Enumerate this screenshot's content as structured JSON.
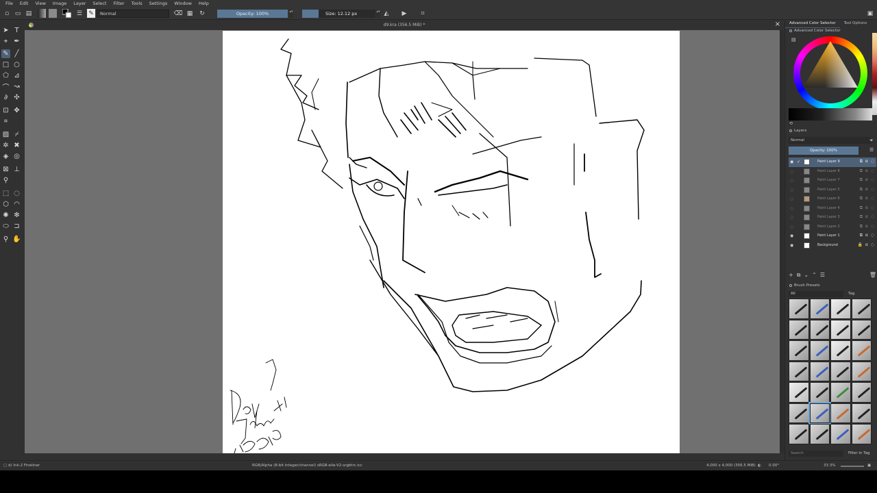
{
  "menu": [
    "File",
    "Edit",
    "View",
    "Image",
    "Layer",
    "Select",
    "Filter",
    "Tools",
    "Settings",
    "Window",
    "Help"
  ],
  "toolbar": {
    "blend_mode": "Normal",
    "opacity": "Opacity: 100%",
    "size": "Size: 12.12 px"
  },
  "document": {
    "title": "d9.kra (356.5 MiB) *",
    "close": "×"
  },
  "signature": {
    "line1": "Day 9",
    "line2": "January 16",
    "line3": "2026"
  },
  "docker": {
    "tabs": [
      "Advanced Color Selector",
      "Tool Options"
    ],
    "color_panel_title": "Advanced Color Selector",
    "layers_title": "Layers",
    "layers_blend": "Normal",
    "layers_opacity": "Opacity: 100%",
    "layers": [
      {
        "name": "Paint Layer 9",
        "state": "active"
      },
      {
        "name": "Paint Layer 8",
        "state": "hidden"
      },
      {
        "name": "Paint Layer 7",
        "state": "hidden"
      },
      {
        "name": "Paint Layer 5",
        "state": "hidden"
      },
      {
        "name": "Paint Layer 6",
        "state": "hidden"
      },
      {
        "name": "Paint Layer 4",
        "state": "hidden"
      },
      {
        "name": "Paint Layer 3",
        "state": "hidden"
      },
      {
        "name": "Paint Layer 2",
        "state": "hidden"
      },
      {
        "name": "Paint Layer 1",
        "state": "visible"
      },
      {
        "name": "Background",
        "state": "visible"
      }
    ],
    "brush_title": "Brush Presets",
    "brush_filter": "All",
    "brush_tag": "Tag",
    "brush_search": "Search",
    "filter_in_tag": "Filter in Tag"
  },
  "status": {
    "brush": "d) Ink-2 Fineliner",
    "color_space": "RGB/Alpha (8-bit integer/channel)  sRGB-elle-V2-srgbtrc.icc",
    "dimensions": "4,000 x 4,000 (356.5 MiB)",
    "rotation": "0.00°",
    "zoom": "33.3%"
  },
  "colors": {
    "accent": "#5a7896",
    "panel": "#313131",
    "canvas_bg": "#707070",
    "paper": "#ffffff"
  }
}
